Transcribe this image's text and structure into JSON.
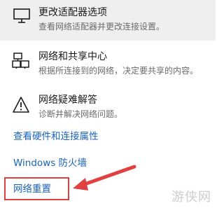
{
  "items": [
    {
      "title": "更改适配器选项",
      "description": "查看网络适配器并更改连接设置。",
      "icon": "monitor-icon"
    },
    {
      "title": "网络和共享中心",
      "description": "根据所连接到的网络，决定要共享的内容。",
      "icon": "network-sharing-icon"
    },
    {
      "title": "网络疑难解答",
      "description": "诊断并解决网络问题。",
      "icon": "warning-icon"
    }
  ],
  "links": {
    "hardware": "查看硬件和连接属性",
    "firewall": "Windows 防火墙",
    "reset": "网络重置"
  },
  "watermark": "游侠网",
  "colors": {
    "link": "#1b63b9",
    "highlight_bg": "#efefef",
    "annotation": "#e04040"
  }
}
